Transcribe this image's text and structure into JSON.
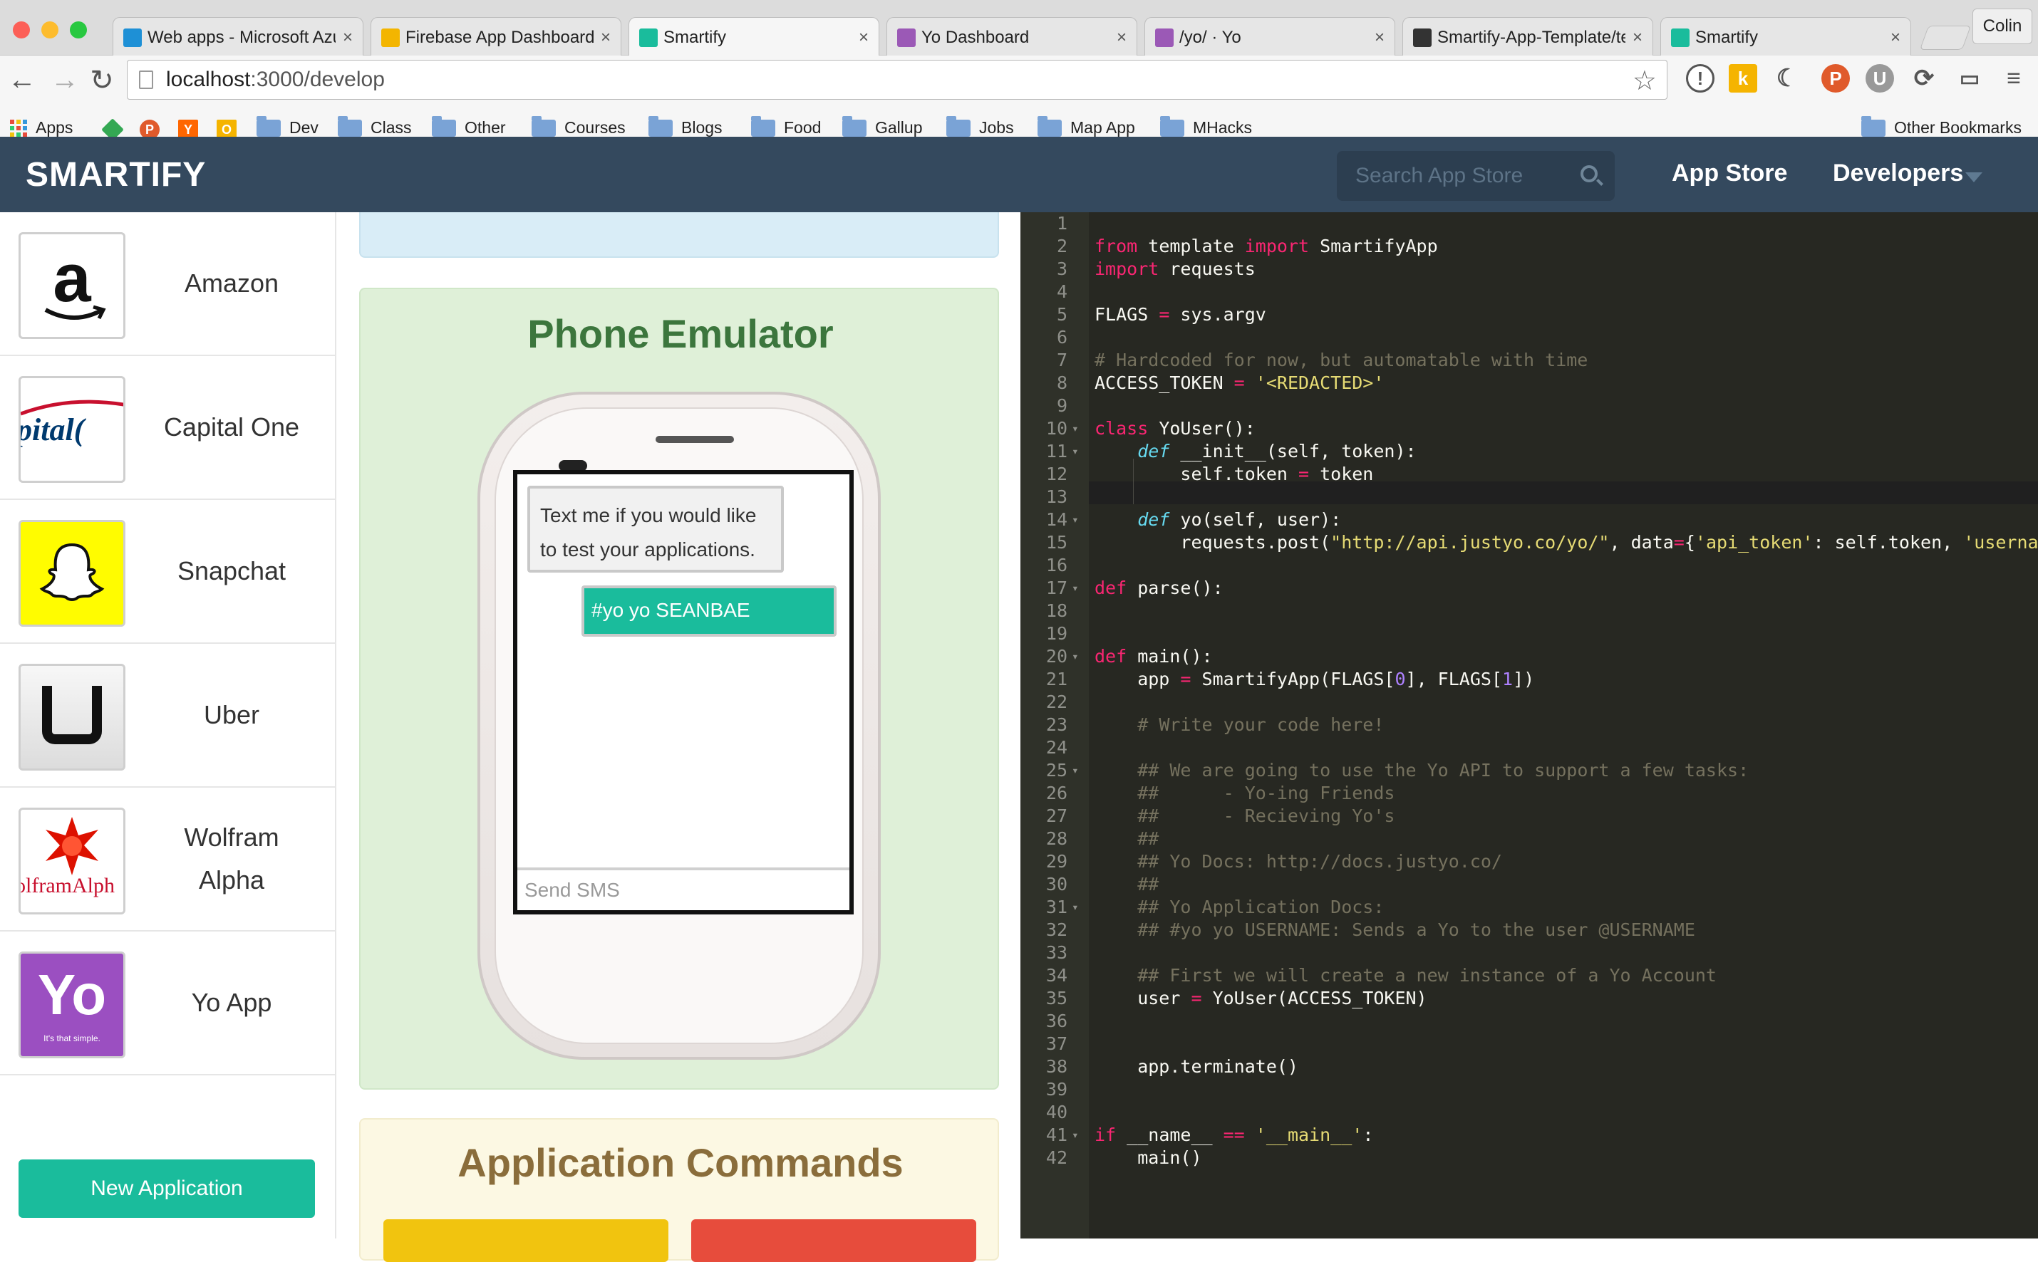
{
  "browser": {
    "tabs": [
      {
        "title": "Web apps - Microsoft Azu",
        "favicon_color": "#1e90d6"
      },
      {
        "title": "Firebase App Dashboard",
        "favicon_color": "#f3b500"
      },
      {
        "title": "Smartify",
        "favicon_color": "#1abc9c"
      },
      {
        "title": "Yo Dashboard",
        "favicon_color": "#9b59b6"
      },
      {
        "title": "/yo/ · Yo",
        "favicon_color": "#9b59b6"
      },
      {
        "title": "Smartify-App-Template/te",
        "favicon_color": "#333333"
      },
      {
        "title": "Smartify",
        "favicon_color": "#1abc9c"
      }
    ],
    "close_glyph": "×",
    "profile_name": "Colin",
    "url_host": "localhost",
    "url_path": ":3000/develop",
    "bookmarks": [
      "Apps",
      "Dev",
      "Class",
      "Other",
      "Courses",
      "Blogs",
      "Food",
      "Gallup",
      "Jobs",
      "Map App",
      "MHacks"
    ],
    "other_bookmarks": "Other Bookmarks"
  },
  "header": {
    "brand": "SMARTIFY",
    "search_placeholder": "Search App Store",
    "nav_app_store": "App Store",
    "nav_developers": "Developers"
  },
  "sidebar": {
    "apps": [
      {
        "name": "Amazon",
        "logo_text": "a"
      },
      {
        "name": "Capital One",
        "logo_text": "pital("
      },
      {
        "name": "Snapchat",
        "logo_text": ""
      },
      {
        "name": "Uber",
        "logo_text": "U"
      },
      {
        "name": "Wolfram Alpha",
        "logo_text": "olframAlph"
      },
      {
        "name": "Yo App",
        "logo_text": "Yo",
        "logo_subtext": "It's that simple."
      }
    ],
    "new_app_button": "New Application"
  },
  "emulator": {
    "title": "Phone Emulator",
    "message_in": "Text me if you would like to test your applications.",
    "message_out": "#yo yo SEANBAE",
    "sms_placeholder": "Send SMS"
  },
  "commands": {
    "title": "Application Commands",
    "button_colors": [
      "#f1c40f",
      "#e74c3c"
    ]
  },
  "editor": {
    "active_line": 13,
    "lines": [
      [],
      [
        [
          "kw",
          "from"
        ],
        [
          "fn",
          " template "
        ],
        [
          "kw",
          "import"
        ],
        [
          "fn",
          " SmartifyApp"
        ]
      ],
      [
        [
          "kw",
          "import"
        ],
        [
          "fn",
          " requests"
        ]
      ],
      [],
      [
        [
          "fn",
          "FLAGS "
        ],
        [
          "op",
          "="
        ],
        [
          "fn",
          " sys.argv"
        ]
      ],
      [],
      [
        [
          "cm",
          "# Hardcoded for now, but automatable with time"
        ]
      ],
      [
        [
          "fn",
          "ACCESS_TOKEN "
        ],
        [
          "op",
          "="
        ],
        [
          "fn",
          " "
        ],
        [
          "st",
          "'<REDACTED>'"
        ]
      ],
      [],
      [
        [
          "kw",
          "class"
        ],
        [
          "fn",
          " YoUser():"
        ]
      ],
      [
        [
          "fn",
          "    "
        ],
        [
          "df",
          "def"
        ],
        [
          "fn",
          " __init__(self, token):"
        ]
      ],
      [
        [
          "fn",
          "        self.token "
        ],
        [
          "op",
          "="
        ],
        [
          "fn",
          " token"
        ]
      ],
      [
        [
          "fn",
          "        "
        ]
      ],
      [
        [
          "fn",
          "    "
        ],
        [
          "df",
          "def"
        ],
        [
          "fn",
          " yo(self, user):"
        ]
      ],
      [
        [
          "fn",
          "        requests.post("
        ],
        [
          "st",
          "\"http://api.justyo.co/yo/\""
        ],
        [
          "fn",
          ", data"
        ],
        [
          "op",
          "="
        ],
        [
          "fn",
          "{"
        ],
        [
          "st",
          "'api_token'"
        ],
        [
          "fn",
          ": self.token, "
        ],
        [
          "st",
          "'username'"
        ],
        [
          "fn",
          ":"
        ]
      ],
      [],
      [
        [
          "kw",
          "def"
        ],
        [
          "fn",
          " parse():"
        ]
      ],
      [],
      [],
      [
        [
          "kw",
          "def"
        ],
        [
          "fn",
          " main():"
        ]
      ],
      [
        [
          "fn",
          "    app "
        ],
        [
          "op",
          "="
        ],
        [
          "fn",
          " SmartifyApp(FLAGS["
        ],
        [
          "nm",
          "0"
        ],
        [
          "fn",
          "], FLAGS["
        ],
        [
          "nm",
          "1"
        ],
        [
          "fn",
          "])"
        ]
      ],
      [],
      [
        [
          "fn",
          "    "
        ],
        [
          "cm",
          "# Write your code here!"
        ]
      ],
      [],
      [
        [
          "fn",
          "    "
        ],
        [
          "cm",
          "## We are going to use the Yo API to support a few tasks:"
        ]
      ],
      [
        [
          "fn",
          "    "
        ],
        [
          "cm",
          "##      - Yo-ing Friends"
        ]
      ],
      [
        [
          "fn",
          "    "
        ],
        [
          "cm",
          "##      - Recieving Yo's"
        ]
      ],
      [
        [
          "fn",
          "    "
        ],
        [
          "cm",
          "##"
        ]
      ],
      [
        [
          "fn",
          "    "
        ],
        [
          "cm",
          "## Yo Docs: http://docs.justyo.co/"
        ]
      ],
      [
        [
          "fn",
          "    "
        ],
        [
          "cm",
          "##"
        ]
      ],
      [
        [
          "fn",
          "    "
        ],
        [
          "cm",
          "## Yo Application Docs:"
        ]
      ],
      [
        [
          "fn",
          "    "
        ],
        [
          "cm",
          "## #yo yo USERNAME: Sends a Yo to the user @USERNAME"
        ]
      ],
      [],
      [
        [
          "fn",
          "    "
        ],
        [
          "cm",
          "## First we will create a new instance of a Yo Account"
        ]
      ],
      [
        [
          "fn",
          "    user "
        ],
        [
          "op",
          "="
        ],
        [
          "fn",
          " YoUser(ACCESS_TOKEN)"
        ]
      ],
      [],
      [],
      [
        [
          "fn",
          "    app.terminate()"
        ]
      ],
      [],
      [],
      [
        [
          "kw",
          "if"
        ],
        [
          "fn",
          " __name__ "
        ],
        [
          "op",
          "=="
        ],
        [
          "fn",
          " "
        ],
        [
          "st",
          "'__main__'"
        ],
        [
          "fn",
          ":"
        ]
      ],
      [
        [
          "fn",
          "    main()"
        ]
      ]
    ],
    "fold_lines": [
      10,
      11,
      14,
      17,
      20,
      25,
      31,
      41
    ],
    "fold_glyph": "▾"
  }
}
